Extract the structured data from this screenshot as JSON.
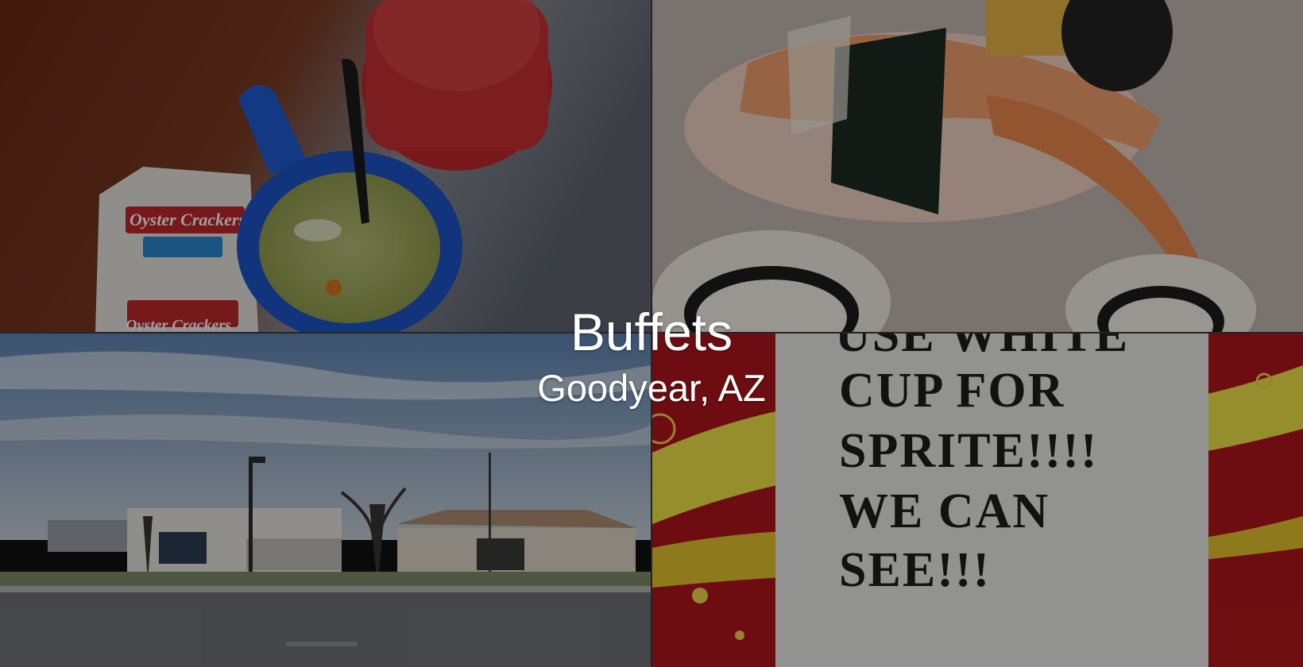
{
  "hero": {
    "title": "Buffets",
    "location": "Goodyear, AZ"
  },
  "photos": {
    "soup": {
      "cracker_label_1": "Oyster Crackers",
      "cracker_label_2": "Oyster Crackers"
    },
    "sign": {
      "line_0": "USE WHITE",
      "line_1": "CUP FOR",
      "line_2": "SPRITE!!!!",
      "line_3": "WE CAN",
      "line_4": "SEE!!!"
    }
  },
  "colors": {
    "text": "#ffffff",
    "overlay": "rgba(0,0,0,0.38)"
  }
}
